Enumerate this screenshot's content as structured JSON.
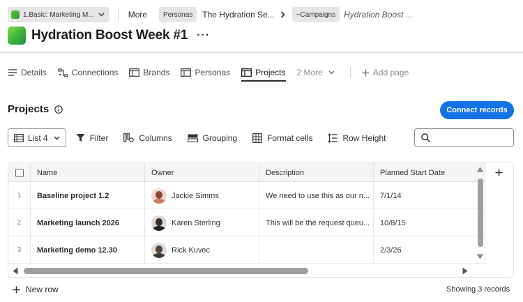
{
  "breadcrumb": {
    "workspace": "1.Basic: Marketing M...",
    "more": "More",
    "personas_tag": "Personas",
    "persona_name": "The Hydration Se...",
    "campaigns_tag": "~Campaigns",
    "campaign_name": "Hydration Boost ..."
  },
  "header": {
    "title": "Hydration Boost Week #1",
    "kebab": "···"
  },
  "tabs": [
    {
      "label": "Details",
      "icon": "details-icon"
    },
    {
      "label": "Connections",
      "icon": "connections-icon"
    },
    {
      "label": "Brands",
      "icon": "table-icon"
    },
    {
      "label": "Personas",
      "icon": "table-icon"
    },
    {
      "label": "Projects",
      "icon": "table-icon",
      "active": true
    },
    {
      "label": "2 More"
    },
    {
      "label": "Add page"
    }
  ],
  "section": {
    "title": "Projects",
    "connect_label": "Connect records"
  },
  "toolbar": {
    "view_label": "List 4",
    "filter": "Filter",
    "columns": "Columns",
    "grouping": "Grouping",
    "format_cells": "Format cells",
    "row_height": "Row Height",
    "search_placeholder": ""
  },
  "table": {
    "headers": [
      "Name",
      "Owner",
      "Description",
      "Planned Start Date"
    ],
    "rows": [
      {
        "num": "1",
        "name": "Baseline project 1.2",
        "owner": "Jackie Simms",
        "description": "We need to use this as our n...",
        "start": "7/1/14"
      },
      {
        "num": "2",
        "name": "Marketing launch 2026",
        "owner": "Karen Sterling",
        "description": "This will be the request queu...",
        "start": "10/8/15"
      },
      {
        "num": "3",
        "name": "Marketing demo 12.30",
        "owner": "Rick Kuvec",
        "description": "",
        "start": "2/3/26"
      }
    ]
  },
  "footer": {
    "new_row": "New row",
    "showing": "Showing 3 records"
  },
  "colors": {
    "accent": "#1473e6",
    "brand_green": "#3fb33e"
  }
}
